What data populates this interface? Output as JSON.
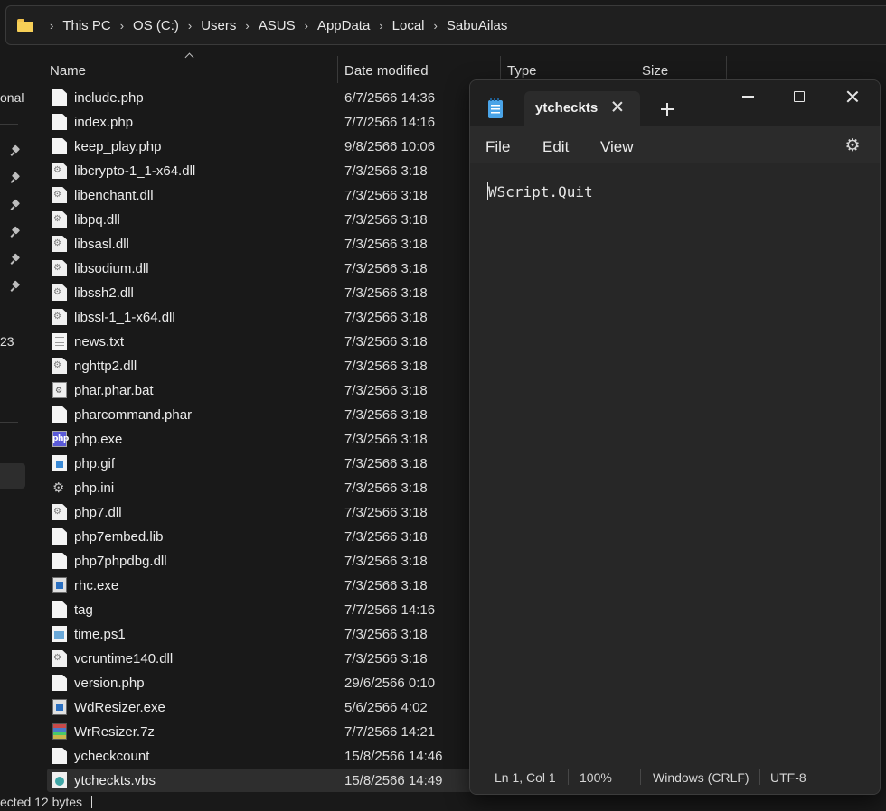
{
  "breadcrumb": [
    "This PC",
    "OS (C:)",
    "Users",
    "ASUS",
    "AppData",
    "Local",
    "SabuAilas"
  ],
  "nav": {
    "partial_top": "onal",
    "partial_mid": "23"
  },
  "columns": {
    "name": "Name",
    "date": "Date modified",
    "type": "Type",
    "size": "Size"
  },
  "files": [
    {
      "name": "include.php",
      "date": "6/7/2566 14:36",
      "icon": "document-icon"
    },
    {
      "name": "index.php",
      "date": "7/7/2566 14:16",
      "icon": "document-icon"
    },
    {
      "name": "keep_play.php",
      "date": "9/8/2566 10:06",
      "icon": "document-icon"
    },
    {
      "name": "libcrypto-1_1-x64.dll",
      "date": "7/3/2566 3:18",
      "icon": "dll-icon"
    },
    {
      "name": "libenchant.dll",
      "date": "7/3/2566 3:18",
      "icon": "dll-icon"
    },
    {
      "name": "libpq.dll",
      "date": "7/3/2566 3:18",
      "icon": "dll-icon"
    },
    {
      "name": "libsasl.dll",
      "date": "7/3/2566 3:18",
      "icon": "dll-icon"
    },
    {
      "name": "libsodium.dll",
      "date": "7/3/2566 3:18",
      "icon": "dll-icon"
    },
    {
      "name": "libssh2.dll",
      "date": "7/3/2566 3:18",
      "icon": "dll-icon"
    },
    {
      "name": "libssl-1_1-x64.dll",
      "date": "7/3/2566 3:18",
      "icon": "dll-icon"
    },
    {
      "name": "news.txt",
      "date": "7/3/2566 3:18",
      "icon": "text-file-icon"
    },
    {
      "name": "nghttp2.dll",
      "date": "7/3/2566 3:18",
      "icon": "dll-icon"
    },
    {
      "name": "phar.phar.bat",
      "date": "7/3/2566 3:18",
      "icon": "batch-file-icon"
    },
    {
      "name": "pharcommand.phar",
      "date": "7/3/2566 3:18",
      "icon": "document-icon"
    },
    {
      "name": "php.exe",
      "date": "7/3/2566 3:18",
      "icon": "php-exe-icon"
    },
    {
      "name": "php.gif",
      "date": "7/3/2566 3:18",
      "icon": "image-file-icon"
    },
    {
      "name": "php.ini",
      "date": "7/3/2566 3:18",
      "icon": "settings-file-icon"
    },
    {
      "name": "php7.dll",
      "date": "7/3/2566 3:18",
      "icon": "dll-icon"
    },
    {
      "name": "php7embed.lib",
      "date": "7/3/2566 3:18",
      "icon": "document-icon"
    },
    {
      "name": "php7phpdbg.dll",
      "date": "7/3/2566 3:18",
      "icon": "document-icon"
    },
    {
      "name": "rhc.exe",
      "date": "7/3/2566 3:18",
      "icon": "application-icon"
    },
    {
      "name": "tag",
      "date": "7/7/2566 14:16",
      "icon": "document-icon"
    },
    {
      "name": "time.ps1",
      "date": "7/3/2566 3:18",
      "icon": "powershell-file-icon"
    },
    {
      "name": "vcruntime140.dll",
      "date": "7/3/2566 3:18",
      "icon": "dll-icon"
    },
    {
      "name": "version.php",
      "date": "29/6/2566 0:10",
      "icon": "document-icon"
    },
    {
      "name": "WdResizer.exe",
      "date": "5/6/2566 4:02",
      "icon": "application-icon"
    },
    {
      "name": "WrResizer.7z",
      "date": "7/7/2566 14:21",
      "icon": "archive-icon"
    },
    {
      "name": "ycheckcount",
      "date": "15/8/2566 14:46",
      "icon": "document-icon"
    },
    {
      "name": "ytcheckts.vbs",
      "date": "15/8/2566 14:49",
      "icon": "vbscript-file-icon",
      "selected": true
    }
  ],
  "status": {
    "text": "ected  12 bytes"
  },
  "notepad": {
    "tab_title": "ytcheckts",
    "menu": {
      "file": "File",
      "edit": "Edit",
      "view": "View"
    },
    "content": "WScript.Quit",
    "statusbar": {
      "position": "Ln 1, Col 1",
      "zoom": "100%",
      "line_ending": "Windows (CRLF)",
      "encoding": "UTF-8"
    }
  }
}
